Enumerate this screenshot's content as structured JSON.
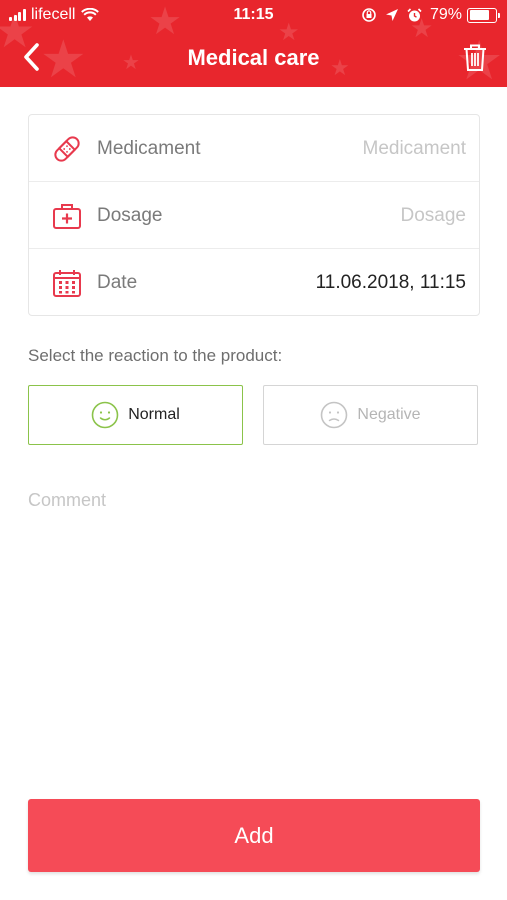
{
  "status_bar": {
    "carrier": "lifecell",
    "time": "11:15",
    "battery_percent": "79%",
    "battery_level": 0.79
  },
  "header": {
    "title": "Medical care",
    "back_icon": "chevron-left-icon",
    "delete_icon": "trash-icon"
  },
  "form": {
    "medicament": {
      "label": "Medicament",
      "placeholder": "Medicament",
      "value": "",
      "icon": "bandage-icon"
    },
    "dosage": {
      "label": "Dosage",
      "placeholder": "Dosage",
      "value": "",
      "icon": "first-aid-kit-icon"
    },
    "date": {
      "label": "Date",
      "value": "11.06.2018, 11:15",
      "icon": "calendar-icon"
    }
  },
  "reaction": {
    "prompt": "Select the reaction to the product:",
    "options": [
      {
        "label": "Normal",
        "icon": "smile-icon",
        "selected": true
      },
      {
        "label": "Negative",
        "icon": "frown-icon",
        "selected": false
      }
    ]
  },
  "comment": {
    "placeholder": "Comment",
    "value": ""
  },
  "add_button": {
    "label": "Add"
  },
  "colors": {
    "header": "#e8262d",
    "accent_icon": "#e8394d",
    "selected_border": "#8bc34a",
    "add_button": "#f54b57"
  }
}
